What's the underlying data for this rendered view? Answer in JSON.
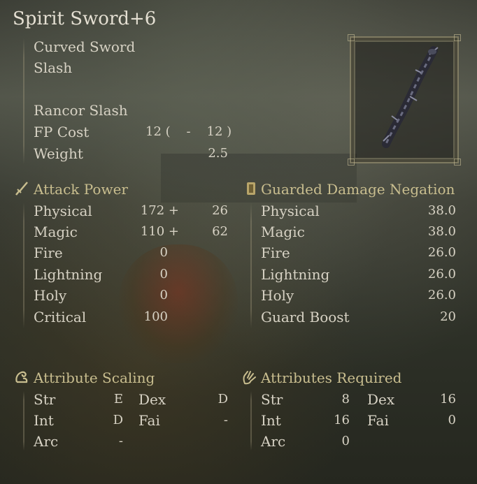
{
  "item": {
    "name": "Spirit Sword+6",
    "weapon_type": "Curved Sword",
    "damage_type": "Slash",
    "skill": "Rancor Slash",
    "fp_cost_label": "FP Cost",
    "fp_cost_value": "12 (    -    12 )",
    "weight_label": "Weight",
    "weight_value": "2.5"
  },
  "attack_power": {
    "header": "Attack Power",
    "rows": [
      {
        "label": "Physical",
        "base": "172 +",
        "bonus": "26"
      },
      {
        "label": "Magic",
        "base": "110 +",
        "bonus": "62"
      },
      {
        "label": "Fire",
        "base": "0",
        "bonus": ""
      },
      {
        "label": "Lightning",
        "base": "0",
        "bonus": ""
      },
      {
        "label": "Holy",
        "base": "0",
        "bonus": ""
      },
      {
        "label": "Critical",
        "base": "100",
        "bonus": ""
      }
    ]
  },
  "guarded_damage_negation": {
    "header": "Guarded Damage Negation",
    "rows": [
      {
        "label": "Physical",
        "value": "38.0"
      },
      {
        "label": "Magic",
        "value": "38.0"
      },
      {
        "label": "Fire",
        "value": "26.0"
      },
      {
        "label": "Lightning",
        "value": "26.0"
      },
      {
        "label": "Holy",
        "value": "26.0"
      },
      {
        "label": "Guard Boost",
        "value": "20"
      }
    ]
  },
  "attribute_scaling": {
    "header": "Attribute Scaling",
    "rows": [
      {
        "label": "Str",
        "value": "E"
      },
      {
        "label": "Dex",
        "value": "D"
      },
      {
        "label": "Int",
        "value": "D"
      },
      {
        "label": "Fai",
        "value": "-"
      },
      {
        "label": "Arc",
        "value": "-"
      }
    ]
  },
  "attributes_required": {
    "header": "Attributes Required",
    "rows": [
      {
        "label": "Str",
        "value": "8"
      },
      {
        "label": "Dex",
        "value": "16"
      },
      {
        "label": "Int",
        "value": "16"
      },
      {
        "label": "Fai",
        "value": "0"
      },
      {
        "label": "Arc",
        "value": "0"
      }
    ]
  },
  "icons": {
    "attack": "sword-icon",
    "guard": "shield-icon",
    "scaling": "flexed-arm-icon",
    "required": "open-hand-icon"
  },
  "colors": {
    "text": "#d7d2c4",
    "header": "#c9be8f",
    "frame": "#beb48c"
  }
}
